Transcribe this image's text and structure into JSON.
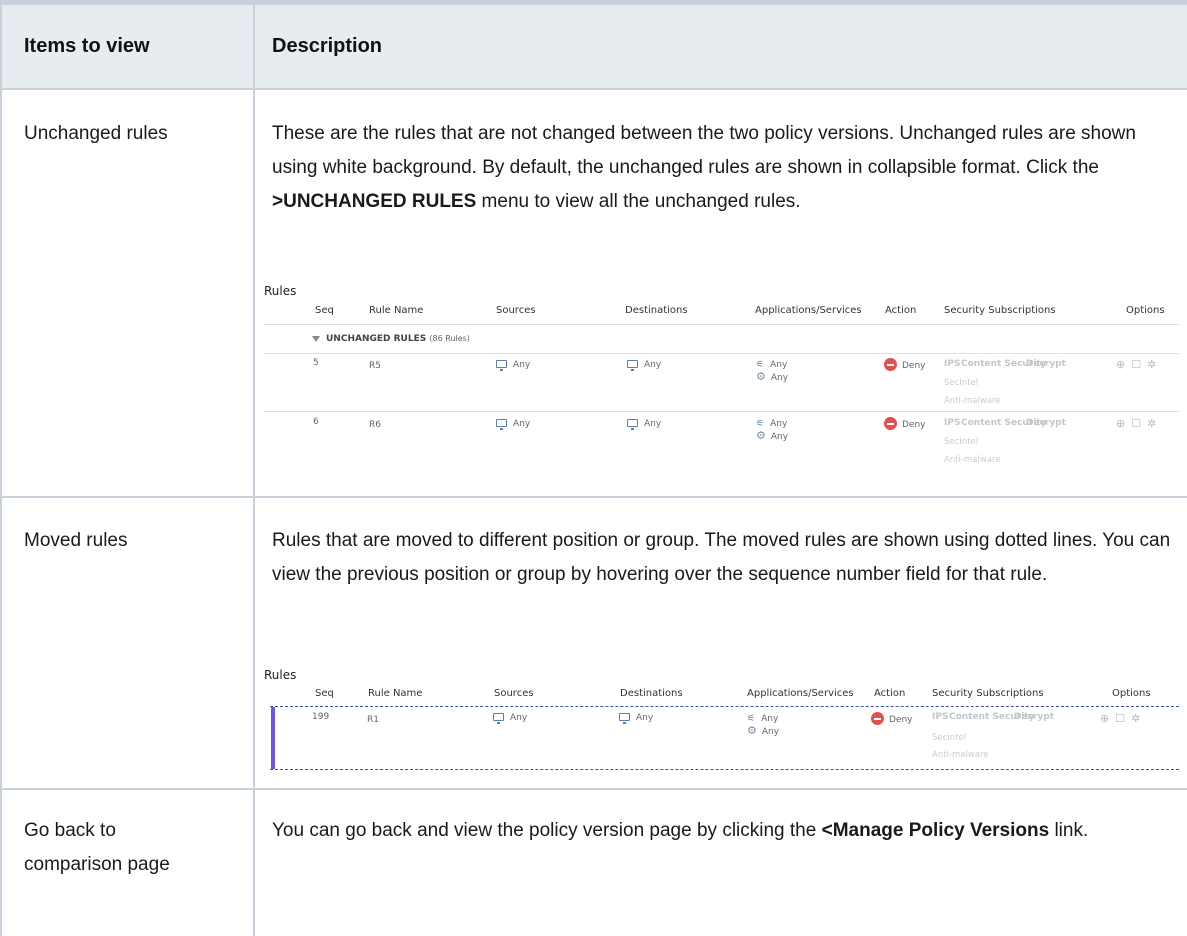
{
  "table": {
    "col1_header": "Items to view",
    "col2_header": "Description"
  },
  "rows": [
    {
      "label": "Unchanged rules",
      "desc_pre": "These are the rules that are not changed between the two policy versions. Unchanged rules are shown using white background. By default, the unchanged rules are shown in collapsible format. Click the ",
      "desc_bold": ">UNCHANGED RULES",
      "desc_post": " menu to view all the unchanged rules."
    },
    {
      "label": "Moved rules",
      "desc": "Rules that are moved to different position or group. The moved rules are shown using dotted lines. You can view the previous position or group by hovering over the sequence number field for that rule."
    },
    {
      "label_line1": "Go back to",
      "label_line2": "comparison page",
      "desc_pre": "You can go back and view the policy version page by clicking the ",
      "desc_bold": "<Manage Policy Versions",
      "desc_post": " link."
    }
  ],
  "rules_panel": {
    "title": "Rules",
    "columns": {
      "seq": "Seq",
      "rule_name": "Rule Name",
      "sources": "Sources",
      "destinations": "Destinations",
      "apps": "Applications/Services",
      "action": "Action",
      "security": "Security Subscriptions",
      "options": "Options"
    },
    "unchanged_group": {
      "label": "UNCHANGED RULES",
      "count": "(86 Rules)"
    },
    "any": "Any",
    "deny": "Deny",
    "subs_ips": "IPS",
    "subs_content": "Content Security",
    "subs_decrypt": "Decrypt",
    "subs_secintel": "SecIntel",
    "subs_antimalware": "Anti-malware",
    "unchanged_rules": [
      {
        "seq": "5",
        "name": "R5"
      },
      {
        "seq": "6",
        "name": "R6"
      }
    ],
    "moved_rule": {
      "seq": "199",
      "name": "R1"
    }
  },
  "colors": {
    "header_bg": "#e7ecf0",
    "border": "#c9d2dc",
    "deny_red": "#e05050",
    "moved_accent": "#6a55e6",
    "dash_blue": "#3a4fb8"
  }
}
